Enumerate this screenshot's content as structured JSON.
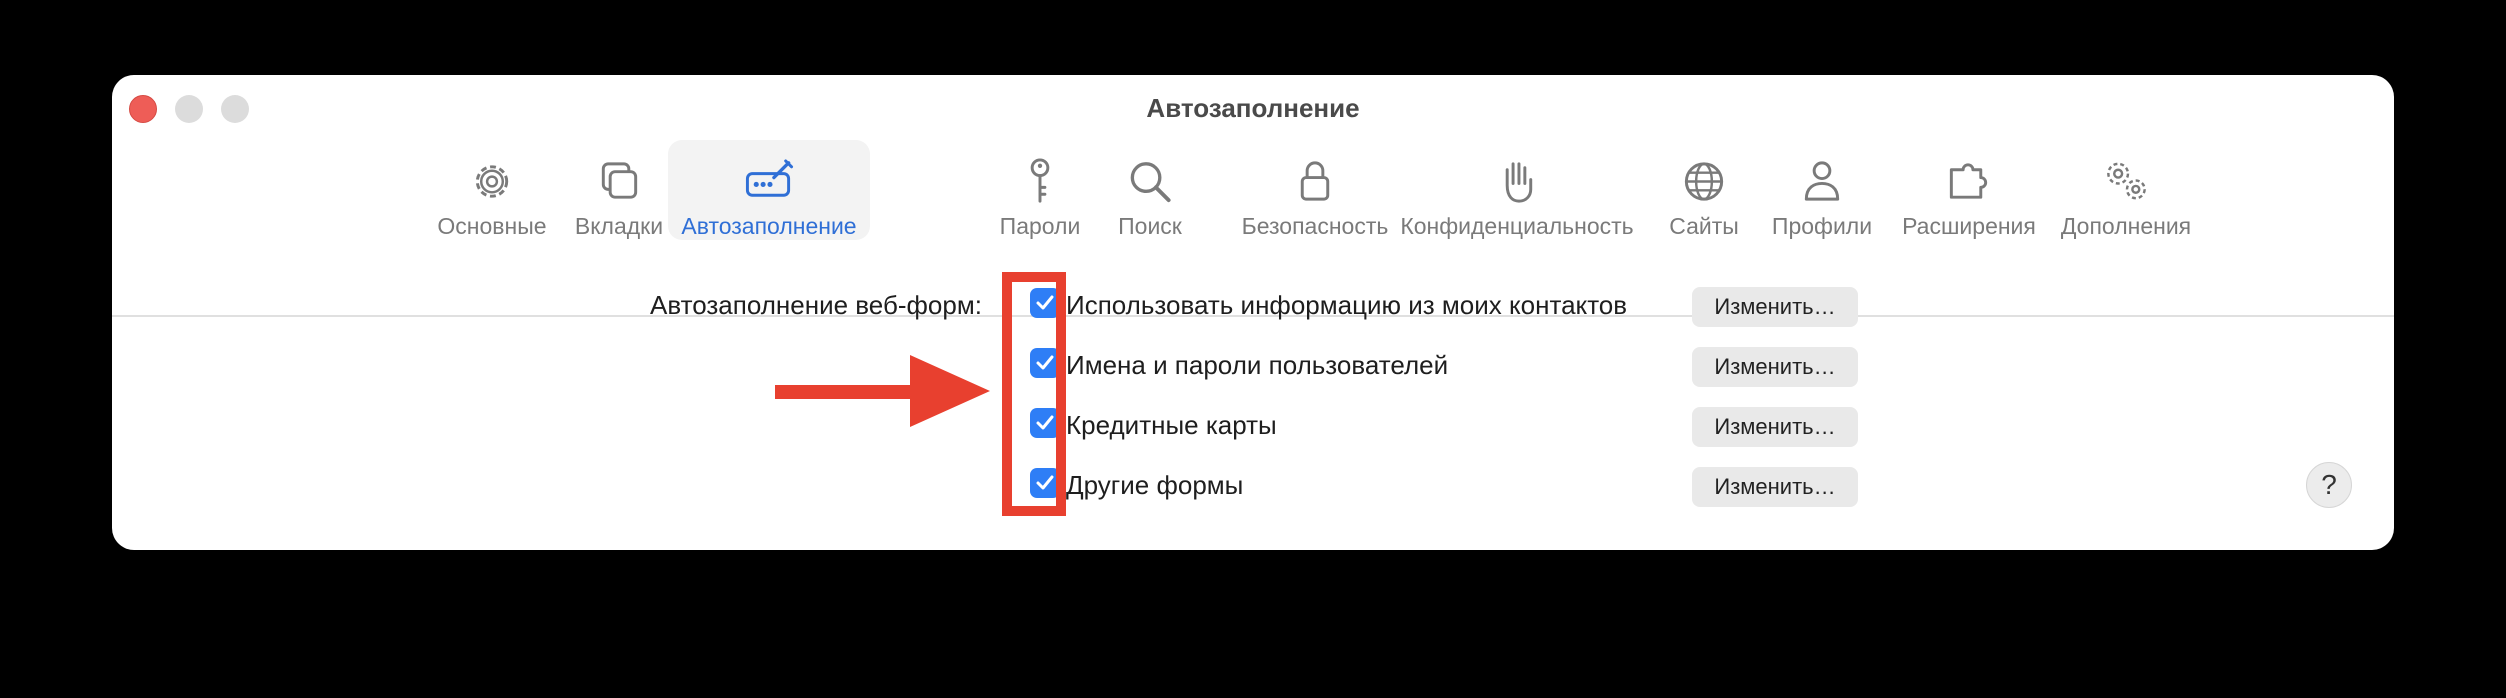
{
  "window": {
    "title": "Автозаполнение"
  },
  "toolbar": {
    "tabs": [
      {
        "label": "Основные",
        "icon": "gear-icon"
      },
      {
        "label": "Вкладки",
        "icon": "tabs-icon"
      },
      {
        "label": "Автозаполнение",
        "icon": "autofill-icon",
        "selected": true
      },
      {
        "label": "Пароли",
        "icon": "key-icon"
      },
      {
        "label": "Поиск",
        "icon": "search-icon"
      },
      {
        "label": "Безопасность",
        "icon": "lock-icon"
      },
      {
        "label": "Конфиденциальность",
        "icon": "hand-icon"
      },
      {
        "label": "Сайты",
        "icon": "globe-icon"
      },
      {
        "label": "Профили",
        "icon": "person-icon"
      },
      {
        "label": "Расширения",
        "icon": "puzzle-icon"
      },
      {
        "label": "Дополнения",
        "icon": "gears-icon"
      }
    ]
  },
  "autofill": {
    "section_label": "Автозаполнение веб-форм:",
    "options": [
      {
        "label": "Использовать информацию из моих контактов",
        "checked": true,
        "button": "Изменить…"
      },
      {
        "label": "Имена и пароли пользователей",
        "checked": true,
        "button": "Изменить…"
      },
      {
        "label": "Кредитные карты",
        "checked": true,
        "button": "Изменить…"
      },
      {
        "label": "Другие формы",
        "checked": true,
        "button": "Изменить…"
      }
    ]
  },
  "help_label": "?",
  "colors": {
    "accent": "#2e7ef6",
    "annotation": "#e8402f",
    "selected_text": "#2f6fd6"
  }
}
